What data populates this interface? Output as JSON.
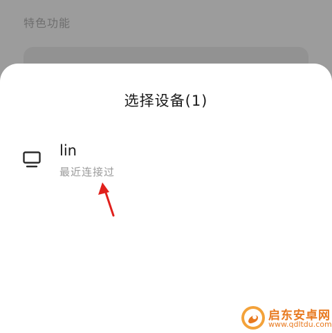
{
  "background": {
    "section_title": "特色功能"
  },
  "sheet": {
    "title": "选择设备(1)",
    "devices": [
      {
        "name": "lin",
        "status": "最近连接过",
        "icon": "monitor-icon"
      }
    ]
  },
  "annotation": {
    "icon": "red-arrow-icon",
    "color": "#e0201c"
  },
  "watermark": {
    "text": "启东安卓网",
    "url": "www.qdltdu.com",
    "color": "#e8791f"
  }
}
